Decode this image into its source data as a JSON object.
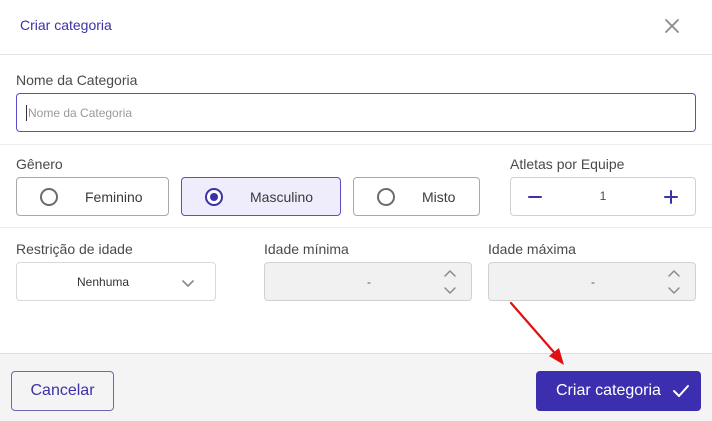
{
  "header": {
    "title": "Criar categoria",
    "close_icon": "close-icon"
  },
  "category_name": {
    "label": "Nome da Categoria",
    "placeholder": "Nome da Categoria",
    "value": ""
  },
  "gender": {
    "label": "Gênero",
    "options": [
      {
        "label": "Feminino",
        "selected": false
      },
      {
        "label": "Masculino",
        "selected": true
      },
      {
        "label": "Misto",
        "selected": false
      }
    ]
  },
  "athletes_per_team": {
    "label": "Atletas por Equipe",
    "value": "1",
    "decrement_icon": "minus-icon",
    "increment_icon": "plus-icon"
  },
  "age_restriction": {
    "label": "Restrição de idade",
    "value": "Nenhuma"
  },
  "min_age": {
    "label": "Idade mínima",
    "value": "-"
  },
  "max_age": {
    "label": "Idade máxima",
    "value": "-"
  },
  "footer": {
    "cancel_label": "Cancelar",
    "create_label": "Criar categoria",
    "create_icon": "check-icon"
  },
  "colors": {
    "accent": "#3b2fb0",
    "annotation_arrow": "#e01010"
  }
}
